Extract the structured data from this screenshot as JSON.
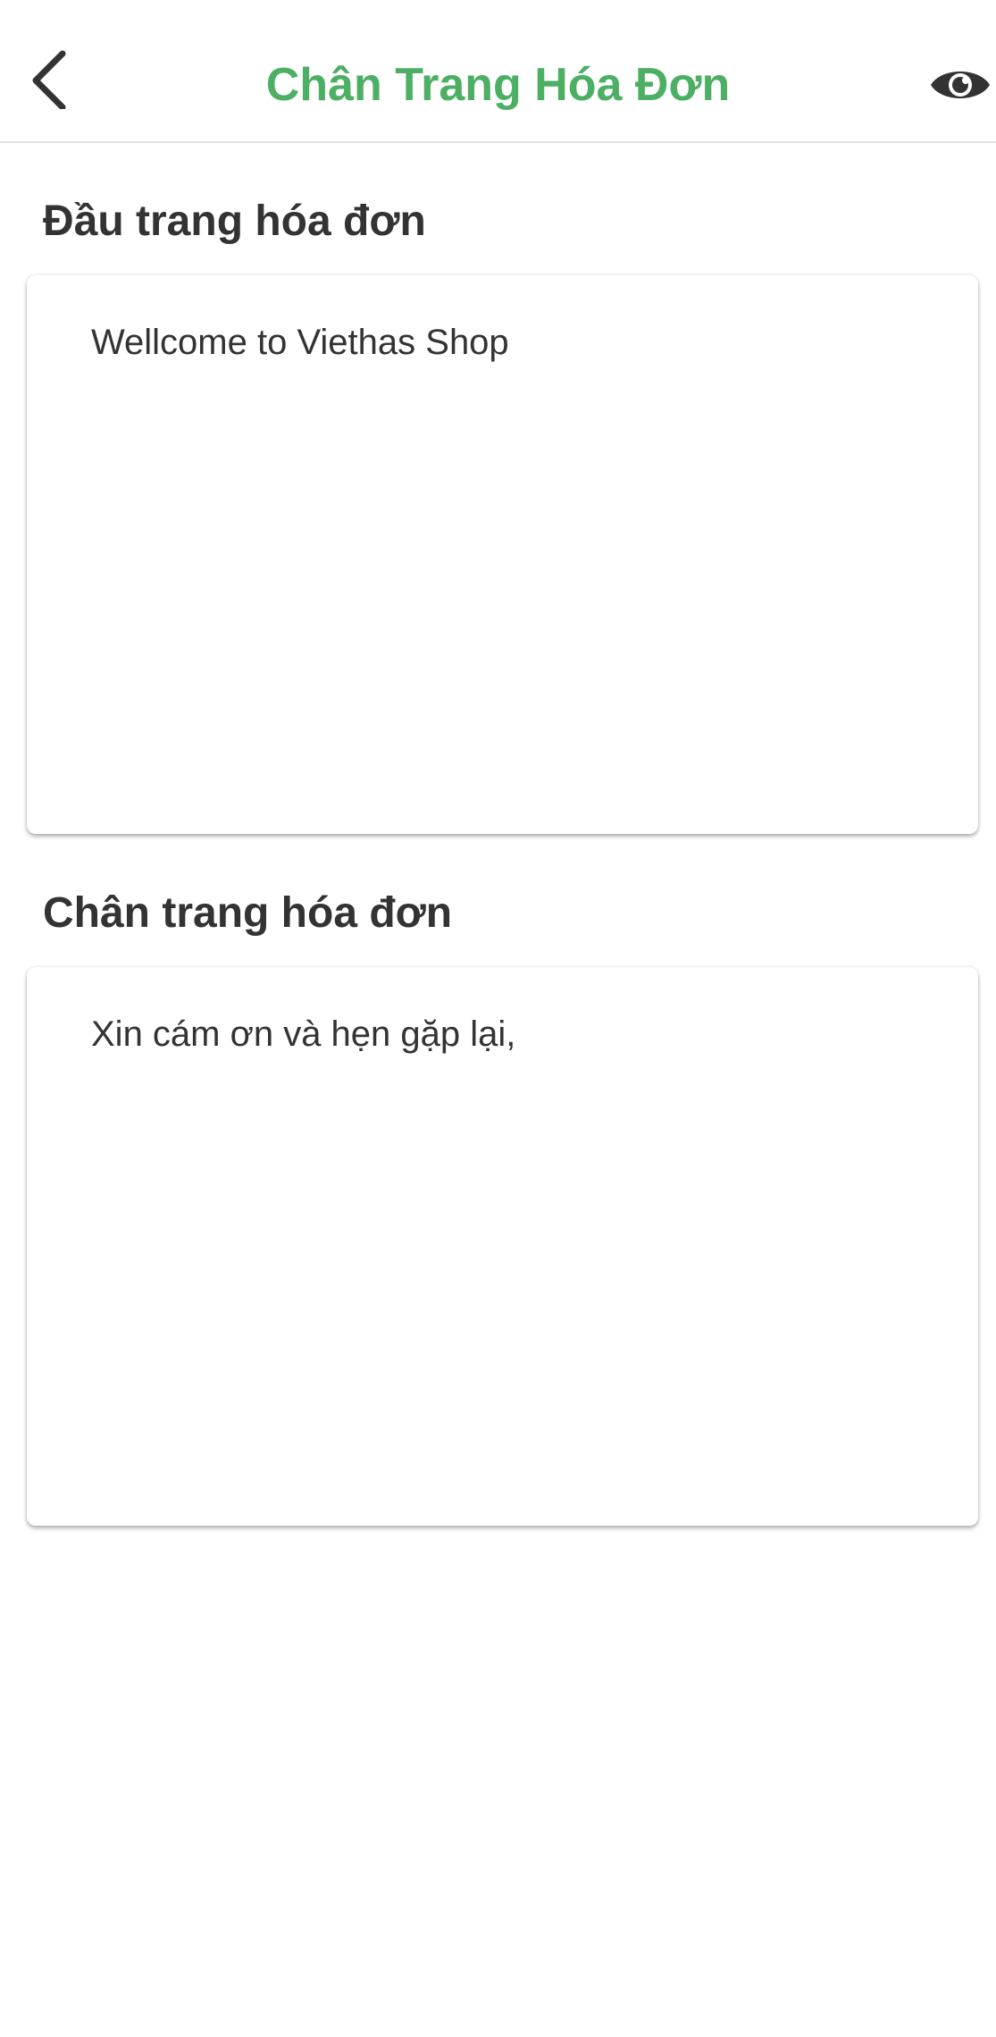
{
  "header": {
    "title": "Chân Trang Hóa Đơn",
    "back_icon": "chevron-left-icon",
    "preview_icon": "eye-icon"
  },
  "invoice_header": {
    "label": "Đầu trang hóa đơn",
    "text": "Wellcome to Viethas Shop"
  },
  "invoice_footer": {
    "label": "Chân trang hóa đơn",
    "text": "Xin cám ơn và hẹn gặp lại,"
  },
  "colors": {
    "accent": "#4caf64",
    "text": "#333333",
    "background": "#ffffff",
    "divider": "#e2e2e2"
  }
}
